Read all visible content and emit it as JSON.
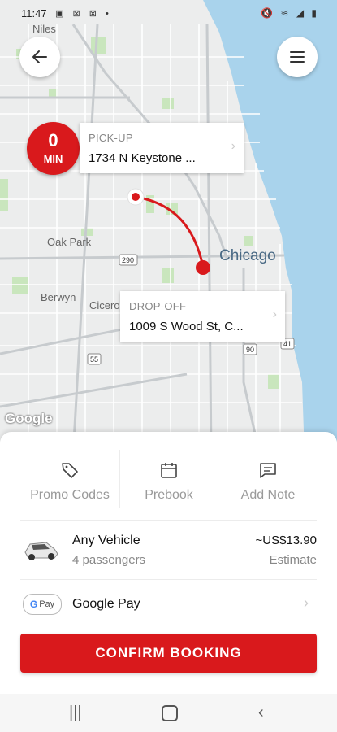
{
  "status_bar": {
    "time": "11:47",
    "left_icons": "▣ ⊠ ⊠ •",
    "right_icons": "🔇 ≋ ◢ ▮"
  },
  "map": {
    "labels": {
      "niles": "Niles",
      "oak_park": "Oak Park",
      "berwyn": "Berwyn",
      "cicero": "Cicero",
      "chicago": "Chicago",
      "hwy_290": "290",
      "hwy_55": "55",
      "hwy_90": "90",
      "hwy_41": "41"
    },
    "google_logo": "Google",
    "route_color": "#d9191c",
    "water_color": "#a9d3ec"
  },
  "eta": {
    "value": "0",
    "unit": "MIN"
  },
  "pickup": {
    "label": "PICK-UP",
    "address": "1734 N Keystone ..."
  },
  "dropoff": {
    "label": "DROP-OFF",
    "address": "1009 S Wood St, C..."
  },
  "actions": {
    "promo": "Promo Codes",
    "prebook": "Prebook",
    "note": "Add Note"
  },
  "vehicle": {
    "name": "Any Vehicle",
    "passengers": "4 passengers",
    "price": "~US$13.90",
    "price_note": "Estimate"
  },
  "payment": {
    "badge_g": "G",
    "badge_text": "Pay",
    "method": "Google Pay"
  },
  "confirm_label": "CONFIRM BOOKING",
  "accent_color": "#d9191c"
}
